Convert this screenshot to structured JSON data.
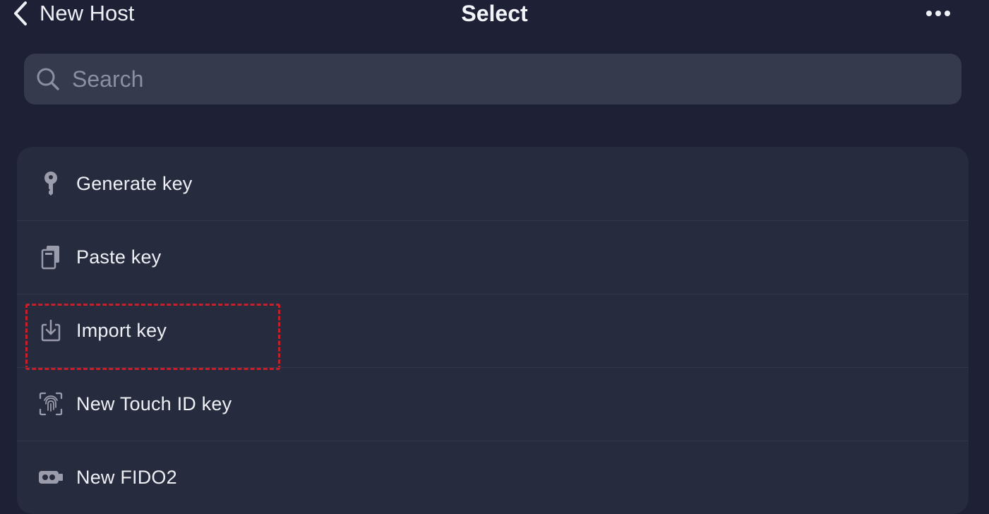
{
  "nav": {
    "back_label": "New Host",
    "title": "Select",
    "back_icon": "chevron-left-icon",
    "more_icon": "ellipsis-icon"
  },
  "search": {
    "placeholder": "Search",
    "value": "",
    "icon": "search-icon"
  },
  "list": {
    "items": [
      {
        "label": "Generate key",
        "icon": "key-icon"
      },
      {
        "label": "Paste key",
        "icon": "clipboard-icon"
      },
      {
        "label": "Import key",
        "icon": "import-icon",
        "highlighted": true
      },
      {
        "label": "New Touch ID key",
        "icon": "fingerprint-icon"
      },
      {
        "label": "New FIDO2",
        "icon": "security-key-icon"
      }
    ]
  },
  "colors": {
    "background": "#1e2036",
    "search_background": "#363a4d",
    "card_background": "#272b3e",
    "text": "#eef0f6",
    "icon": "#9a9cab",
    "highlight": "#c8202a"
  }
}
